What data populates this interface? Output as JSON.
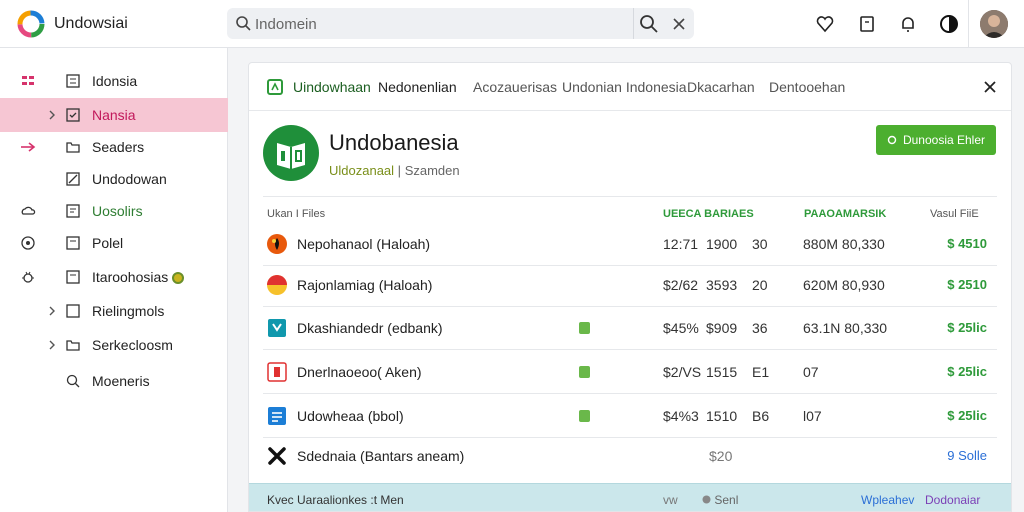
{
  "app": {
    "title": "Undowsiai",
    "logo_icon": "multicolor-ring-logo-icon"
  },
  "search": {
    "placeholder": "Indomein"
  },
  "topbar_icons": [
    "heart-icon",
    "document-icon",
    "bell-icon",
    "contrast-icon",
    "avatar"
  ],
  "sidebar": {
    "items": [
      {
        "label": "Idonsia",
        "lead": "grid-icon",
        "icon": "list-icon"
      },
      {
        "label": "Nansia",
        "lead": "chevron-right-icon",
        "icon": "check-box-icon",
        "active": true
      },
      {
        "label": "Seaders",
        "lead": "arrow-icon",
        "icon": "folder-icon"
      },
      {
        "label": "Undodowan",
        "lead": "",
        "icon": "edit-icon"
      },
      {
        "label": "Uosolirs",
        "lead": "cloud-icon",
        "icon": "doc-icon",
        "green": true
      },
      {
        "label": "Polel",
        "lead": "target-icon",
        "icon": "doc-icon"
      },
      {
        "label": "Itaroohosias",
        "lead": "bug-icon",
        "icon": "doc-icon",
        "badge": true
      },
      {
        "label": "Rielingmols",
        "lead": "chevron-right-icon",
        "icon": "box-icon"
      },
      {
        "label": "Serkecloosm",
        "lead": "chevron-right-icon",
        "icon": "folder-icon"
      },
      {
        "label": "Moeneris",
        "lead": "",
        "icon": "search-icon"
      }
    ]
  },
  "tabs": [
    {
      "label": "Uindowhaan",
      "active": true
    },
    {
      "label": "Nedonenlian"
    },
    {
      "label": "Acozauerisas"
    },
    {
      "label": "Undonian Indonesia"
    },
    {
      "label": "Dkacarhan"
    },
    {
      "label": "Dentooehan"
    }
  ],
  "hero": {
    "title": "Undobanesia",
    "sub_highlight": "Uldozanaal",
    "sub_separator": "|",
    "sub_rest": "Szamden",
    "button_label": "Dunoosia Ehler"
  },
  "table": {
    "headers": {
      "name": "Ukan I Files",
      "col2": "UEECA BARIAES",
      "col3": "PAAOAMARSIK",
      "col4": "Vasul FiiE"
    },
    "rows": [
      {
        "icon": "flame-icon",
        "name": "Nepohanaol (Haloah)",
        "flag": false,
        "price": "12:71",
        "qty": "1900",
        "code": "30",
        "market": "880M 80,330",
        "total": "$ 4510"
      },
      {
        "icon": "flag-red-yellow-icon",
        "name": "Rajonlamiag (Haloah)",
        "flag": false,
        "price": "$2/62",
        "qty": "3593",
        "code": "20",
        "market": "620M 80,930",
        "total": "$ 2510"
      },
      {
        "icon": "teal-bracket-icon",
        "name": "Dkashiandedr (edbank)",
        "flag": true,
        "price": "$45%",
        "qty": "$909",
        "code": "36",
        "market": "63.1N 80,330",
        "total": "$ 25lic"
      },
      {
        "icon": "red-square-icon",
        "name": "Dnerlnaoeoo( Aken)",
        "flag": true,
        "price": "$2/VS",
        "qty": "1515",
        "code": "E1",
        "market": "07",
        "total": "$ 25lic"
      },
      {
        "icon": "blue-doc-icon",
        "name": "Udowheaa (bbol)",
        "flag": true,
        "price": "$4%3",
        "qty": "1510",
        "code": "B6",
        "market": "l07",
        "total": "$ 25lic"
      }
    ],
    "summary": {
      "icon": "x-mark-icon",
      "name": "Sdednaia (Bantars aneam)",
      "mid": "$20",
      "right": "9 Solle"
    }
  },
  "footer": {
    "left": "Kvec Uaraalionkes :t Men",
    "mid1": "vw",
    "mid2": "Senl",
    "link1": "Wpleahev",
    "link2": "Dodonaiar"
  },
  "colors": {
    "accent_green": "#4caf2f",
    "active_pink": "#f6c6d3",
    "footer_teal": "#cbe7eb"
  }
}
